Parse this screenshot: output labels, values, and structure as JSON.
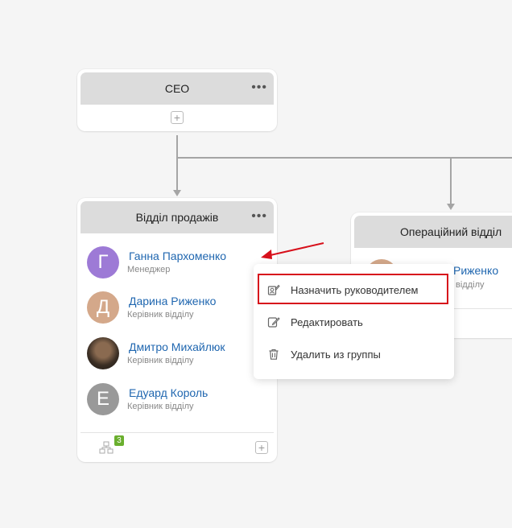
{
  "ceo_card": {
    "title": "CEO"
  },
  "sales_card": {
    "title": "Відділ продажів",
    "members": [
      {
        "initial": "Г",
        "name": "Ганна Пархоменко",
        "role": "Менеджер",
        "color": "#9d7ad6"
      },
      {
        "initial": "Д",
        "name": "Дарина Риженко",
        "role": "Керівник відділу",
        "color": "#d4a88a"
      },
      {
        "initial": "",
        "name": "Дмитро Михайлюк",
        "role": "Керівник відділу",
        "color": "#5a4a3a"
      },
      {
        "initial": "Е",
        "name": "Едуард Король",
        "role": "Керівник відділу",
        "color": "#999999"
      }
    ],
    "subgroup_count": "3"
  },
  "ops_card": {
    "title": "Операційний відділ",
    "member_partial_name": "Риженко",
    "member_partial_role": "відділу"
  },
  "context_menu": {
    "items": [
      {
        "label": "Назначить руководителем",
        "icon": "assign-head-icon"
      },
      {
        "label": "Редактировать",
        "icon": "edit-icon"
      },
      {
        "label": "Удалить из группы",
        "icon": "trash-icon"
      }
    ]
  },
  "colors": {
    "link": "#2067b0",
    "highlight": "#d7101b",
    "connector": "#a5a5a5",
    "badge": "#6aaf2e"
  }
}
